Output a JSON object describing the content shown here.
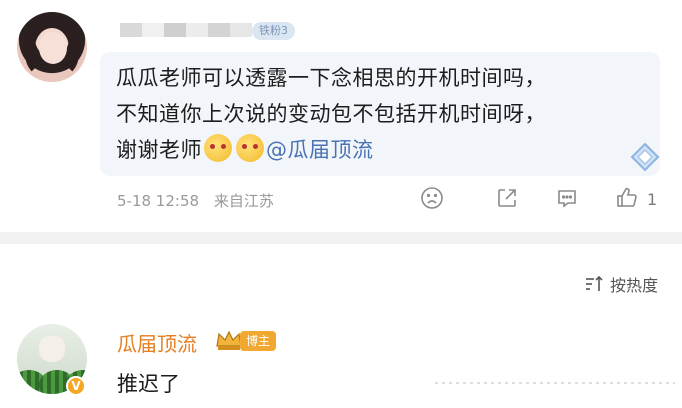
{
  "post": {
    "fan_badge": "铁粉3",
    "content_lines": [
      "瓜瓜老师可以透露一下念相思的开机时间吗，",
      "不知道你上次说的变动包不包括开机时间呀，",
      "谢谢老师"
    ],
    "mention": "@瓜届顶流",
    "timestamp": "5-18 12:58",
    "location": "来自江苏",
    "like_count": "1"
  },
  "sort": {
    "label": "按热度"
  },
  "reply": {
    "author": "瓜届顶流",
    "role_badge": "博主",
    "text": "推迟了"
  },
  "icons": {
    "dislike": "sad-face-icon",
    "share": "share-icon",
    "comment": "comment-icon",
    "like": "thumbs-up-icon",
    "sort": "sort-icon",
    "crown": "crown-icon",
    "verified": "verified-badge-icon"
  },
  "colors": {
    "accent_name": "#e67e22",
    "mention": "#4a73b3",
    "bubble_bg": "#f2f6fb",
    "host_badge": "#f0a830"
  }
}
